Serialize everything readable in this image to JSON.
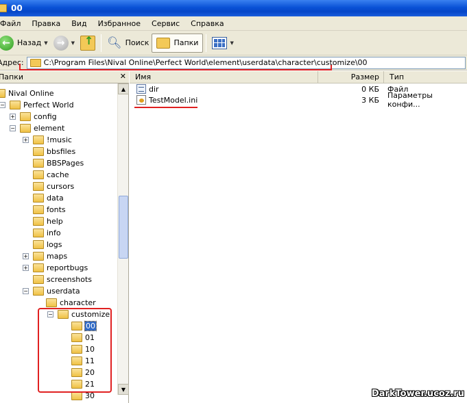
{
  "window": {
    "title": "00"
  },
  "menu": [
    "Файл",
    "Правка",
    "Вид",
    "Избранное",
    "Сервис",
    "Справка"
  ],
  "toolbar": {
    "back_label": "Назад",
    "search_label": "Поиск",
    "folders_label": "Папки"
  },
  "address": {
    "label": "Адрес:",
    "value": "C:\\Program Files\\Nival Online\\Perfect World\\element\\userdata\\character\\customize\\00"
  },
  "folders_pane": {
    "header": "Папки",
    "tree": [
      {
        "label": "Nival Online"
      },
      {
        "label": "Perfect World"
      },
      {
        "label": "config"
      },
      {
        "label": "element"
      },
      {
        "label": "!music"
      },
      {
        "label": "bbsfiles"
      },
      {
        "label": "BBSPages"
      },
      {
        "label": "cache"
      },
      {
        "label": "cursors"
      },
      {
        "label": "data"
      },
      {
        "label": "fonts"
      },
      {
        "label": "help"
      },
      {
        "label": "info"
      },
      {
        "label": "logs"
      },
      {
        "label": "maps"
      },
      {
        "label": "reportbugs"
      },
      {
        "label": "screenshots"
      },
      {
        "label": "userdata"
      },
      {
        "label": "character"
      },
      {
        "label": "customize"
      },
      {
        "label": "00"
      },
      {
        "label": "01"
      },
      {
        "label": "10"
      },
      {
        "label": "11"
      },
      {
        "label": "20"
      },
      {
        "label": "21"
      },
      {
        "label": "30"
      }
    ]
  },
  "columns": {
    "name": "Имя",
    "size": "Размер",
    "type": "Тип"
  },
  "files": [
    {
      "name": "dir",
      "size": "0 КБ",
      "type": "Файл",
      "icon": "text-file-icon"
    },
    {
      "name": "TestModel.ini",
      "size": "3 КБ",
      "type": "Параметры конфи...",
      "icon": "ini-file-icon"
    }
  ],
  "watermark": "DarkTower.ucoz.ru"
}
